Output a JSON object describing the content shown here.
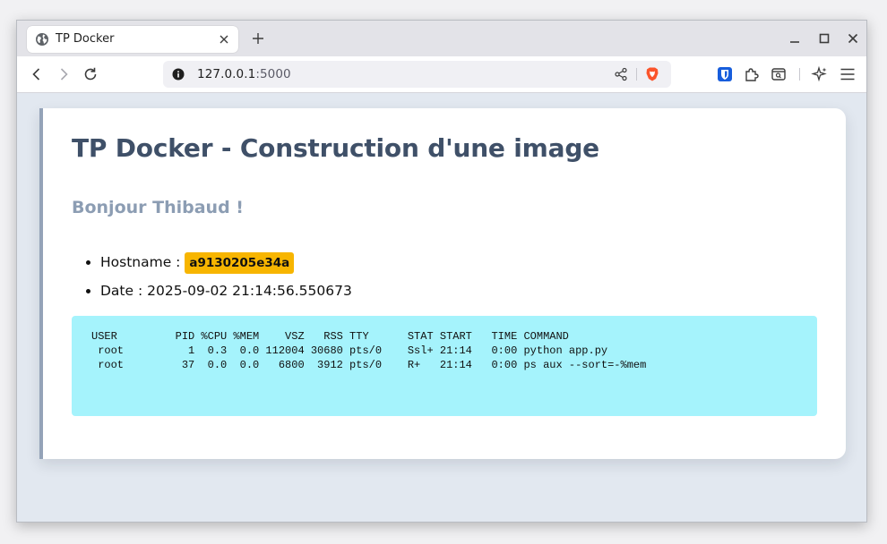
{
  "browser": {
    "tab": {
      "title": "TP Docker"
    },
    "url": {
      "host": "127.0.0.1",
      "port": ":5000"
    },
    "icons": {
      "tab_favicon": "globe-icon",
      "tab_close": "close-icon",
      "new_tab": "plus-icon",
      "minimize": "minimize-icon",
      "maximize": "maximize-icon",
      "close_window": "close-window-icon",
      "back": "back-arrow-icon",
      "forward": "forward-arrow-icon",
      "reload": "reload-icon",
      "site_info": "info-icon",
      "share": "share-icon",
      "brave_shields": "brave-lion-icon",
      "bitwarden": "bitwarden-shield-icon",
      "extensions": "puzzle-icon",
      "sidebar": "sidebar-search-icon",
      "leo_ai": "sparkle-icon",
      "menu": "hamburger-menu-icon"
    }
  },
  "page": {
    "title": "TP Docker - Construction d'une image",
    "greeting": "Bonjour Thibaud !",
    "info": {
      "hostname_label": "Hostname : ",
      "hostname_value": "a9130205e34a",
      "date_label": "Date : ",
      "date_value": "2025-09-02 21:14:56.550673"
    },
    "ps_output": "USER         PID %CPU %MEM    VSZ   RSS TTY      STAT START   TIME COMMAND\n root          1  0.3  0.0 112004 30680 pts/0    Ssl+ 21:14   0:00 python app.py\n root         37  0.0  0.0   6800  3912 pts/0    R+   21:14   0:00 ps aux --sort=-%mem"
  },
  "colors": {
    "title": "#3f5068",
    "greeting": "#8c9db3",
    "badge": "#f7b500",
    "code_bg": "#a5f3fc",
    "page_bg": "#e2e8f0",
    "card_border": "#94a3b8"
  }
}
